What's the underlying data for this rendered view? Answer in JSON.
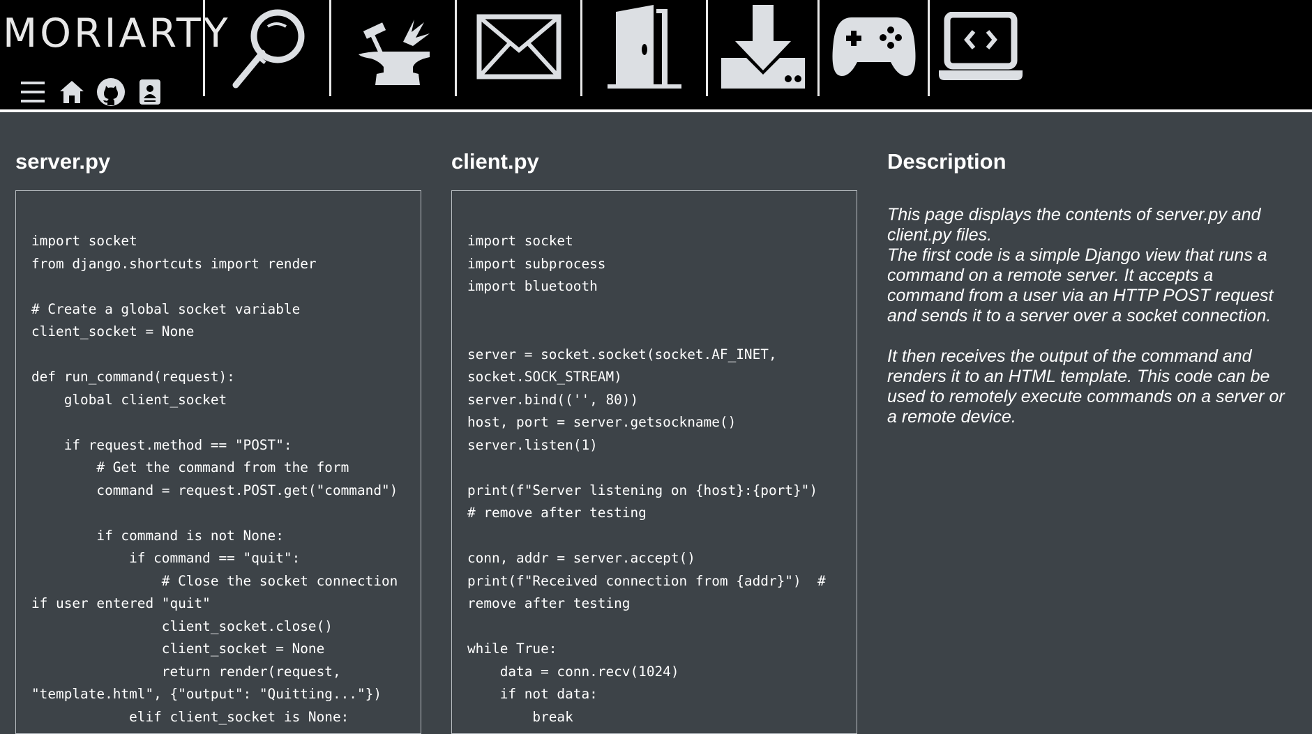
{
  "brand": {
    "logo_text": "MORIARTY",
    "icons": [
      "menu-icon",
      "home-icon",
      "github-icon",
      "contact-card-icon"
    ]
  },
  "nav": {
    "items": [
      {
        "icon": "magnifier-icon"
      },
      {
        "icon": "anvil-hammer-icon"
      },
      {
        "icon": "envelope-icon"
      },
      {
        "icon": "door-icon"
      },
      {
        "icon": "download-drive-icon"
      },
      {
        "icon": "gamepad-icon"
      },
      {
        "icon": "laptop-code-icon"
      }
    ]
  },
  "server": {
    "title": "server.py",
    "code": "import socket\nfrom django.shortcuts import render\n\n# Create a global socket variable\nclient_socket = None\n\ndef run_command(request):\n    global client_socket\n\n    if request.method == \"POST\":\n        # Get the command from the form\n        command = request.POST.get(\"command\")\n\n        if command is not None:\n            if command == \"quit\":\n                # Close the socket connection\nif user entered \"quit\"\n                client_socket.close()\n                client_socket = None\n                return render(request,\n\"template.html\", {\"output\": \"Quitting...\"})\n            elif client_socket is None:"
  },
  "client": {
    "title": "client.py",
    "code": "import socket\nimport subprocess\nimport bluetooth\n\n\nserver = socket.socket(socket.AF_INET,\nsocket.SOCK_STREAM)\nserver.bind(('', 80))\nhost, port = server.getsockname()\nserver.listen(1)\n\nprint(f\"Server listening on {host}:{port}\")\n# remove after testing\n\nconn, addr = server.accept()\nprint(f\"Received connection from {addr}\")  #\nremove after testing\n\nwhile True:\n    data = conn.recv(1024)\n    if not data:\n        break"
  },
  "description": {
    "title": "Description",
    "paragraph1": "This page displays the contents of server.py and client.py files.\nThe first code is a simple Django view that runs a command on a remote server. It accepts a command from a user via an HTTP POST request and sends it to a server over a socket connection.",
    "paragraph2": "It then receives the output of the command and renders it to an HTML template. This code can be used to remotely execute commands on a server or a remote device."
  },
  "colors": {
    "header_bg": "#000000",
    "page_bg": "#3d4348",
    "icon_fill": "#dcdfe3",
    "text": "#ffffff"
  }
}
